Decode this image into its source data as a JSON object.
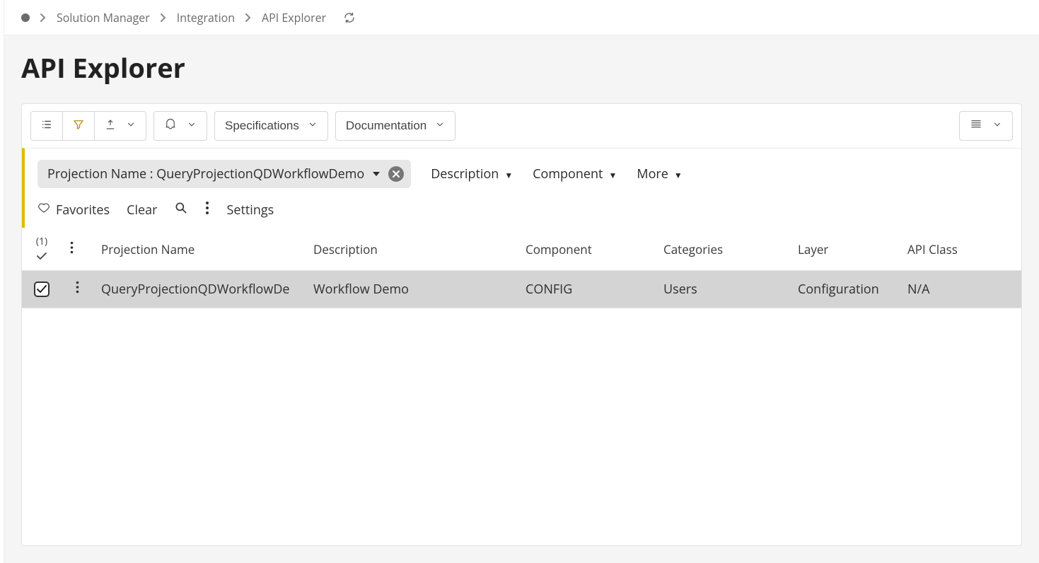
{
  "breadcrumb": {
    "items": [
      "Solution Manager",
      "Integration",
      "API Explorer"
    ]
  },
  "page": {
    "title": "API Explorer"
  },
  "toolbar": {
    "specifications": "Specifications",
    "documentation": "Documentation"
  },
  "filters": {
    "chip_label": "Projection Name : QueryProjectionQDWorkflowDemo",
    "facets": {
      "description": "Description",
      "component": "Component",
      "more": "More"
    },
    "actions": {
      "favorites": "Favorites",
      "clear": "Clear",
      "settings": "Settings"
    }
  },
  "table": {
    "count_label": "(1)",
    "columns": {
      "projection_name": "Projection Name",
      "description": "Description",
      "component": "Component",
      "categories": "Categories",
      "layer": "Layer",
      "api_class": "API Class"
    },
    "rows": [
      {
        "selected": true,
        "projection_name": "QueryProjectionQDWorkflowDe",
        "description": "Workflow Demo",
        "component": "CONFIG",
        "categories": "Users",
        "layer": "Configuration",
        "api_class": "N/A"
      }
    ]
  }
}
